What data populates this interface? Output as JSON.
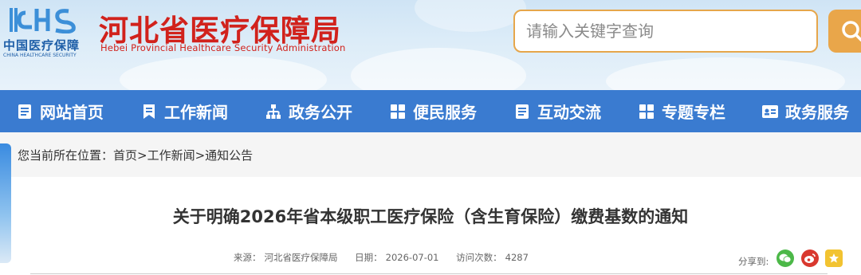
{
  "header": {
    "logo_mark": "CHS",
    "logo_cn": "中国医疗保障",
    "logo_en": "CHINA HEALTHCARE SECURITY",
    "title": "河北省医疗保障局",
    "subtitle": "Hebei Provincial Healthcare Security Administration",
    "search": {
      "placeholder": "请输入关键字查询"
    }
  },
  "nav": {
    "items": [
      {
        "label": "网站首页",
        "icon": "document-icon"
      },
      {
        "label": "工作新闻",
        "icon": "bookmark-icon"
      },
      {
        "label": "政务公开",
        "icon": "sitemap-icon"
      },
      {
        "label": "便民服务",
        "icon": "grid-icon"
      },
      {
        "label": "互动交流",
        "icon": "document-icon"
      },
      {
        "label": "专题专栏",
        "icon": "grid-icon"
      },
      {
        "label": "政务服务",
        "icon": "id-card-icon"
      }
    ]
  },
  "breadcrumb": {
    "text": "您当前所在位置：首页>工作新闻>通知公告"
  },
  "article": {
    "title": "关于明确2026年省本级职工医疗保险（含生育保险）缴费基数的通知",
    "source_label": "来源：",
    "source": "河北省医疗保障局",
    "date_label": "日期：",
    "date": "2026-07-01",
    "views_label": "访问次数：",
    "views": "4287"
  },
  "share": {
    "label": "分享到:",
    "colors": {
      "wechat": "#4cb848",
      "weibo": "#d9382e",
      "favorite": "#f2c331"
    }
  },
  "colors": {
    "nav_bg": "#3a7bd0",
    "brand_red": "#d1221c",
    "search_accent": "#e6a64b"
  }
}
